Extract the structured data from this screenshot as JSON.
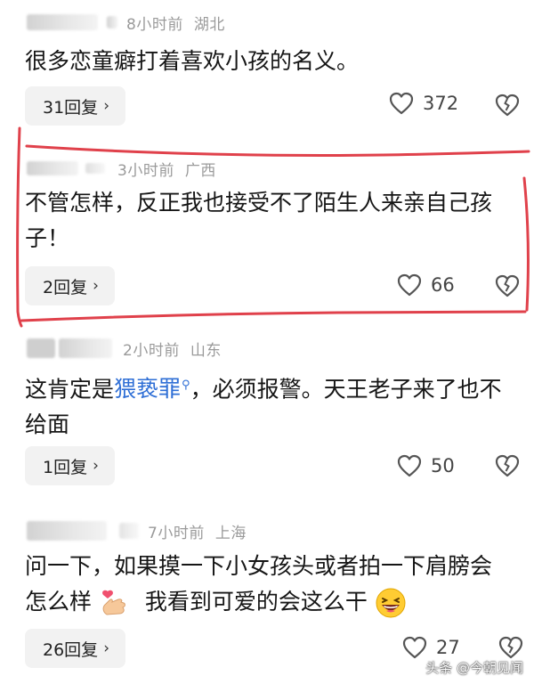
{
  "comments": [
    {
      "time": "8小时前",
      "location": "湖北",
      "text": "很多恋童癖打着喜欢小孩的名义。",
      "replies": "31回复",
      "likes": "372"
    },
    {
      "time": "3小时前",
      "location": "广西",
      "text": "不管怎样，反正我也接受不了陌生人来亲自己孩子！",
      "replies": "2回复",
      "likes": "66"
    },
    {
      "time": "2小时前",
      "location": "山东",
      "text_before": "这肯定是",
      "link": "猥亵罪",
      "text_after": "，必须报警。天王老子来了也不给面",
      "replies": "1回复",
      "likes": "50"
    },
    {
      "time": "7小时前",
      "location": "上海",
      "text_before": "问一下，如果摸一下小女孩头或者拍一下肩膀会怎么样",
      "text_after": "我看到可爱的会这么干",
      "replies": "26回复",
      "likes": "27"
    }
  ],
  "reply_chevron": "›",
  "icons": {
    "like": "heart-outline-icon",
    "dislike": "broken-heart-icon",
    "search": "search-icon",
    "emoji_heart_hand": "finger-heart-emoji",
    "emoji_laugh": "laughing-emoji"
  },
  "colors": {
    "highlight": "#e0414b",
    "link": "#2f6fd6",
    "meta": "#9a9a9a"
  },
  "watermark": "头条 @今朝见闻"
}
